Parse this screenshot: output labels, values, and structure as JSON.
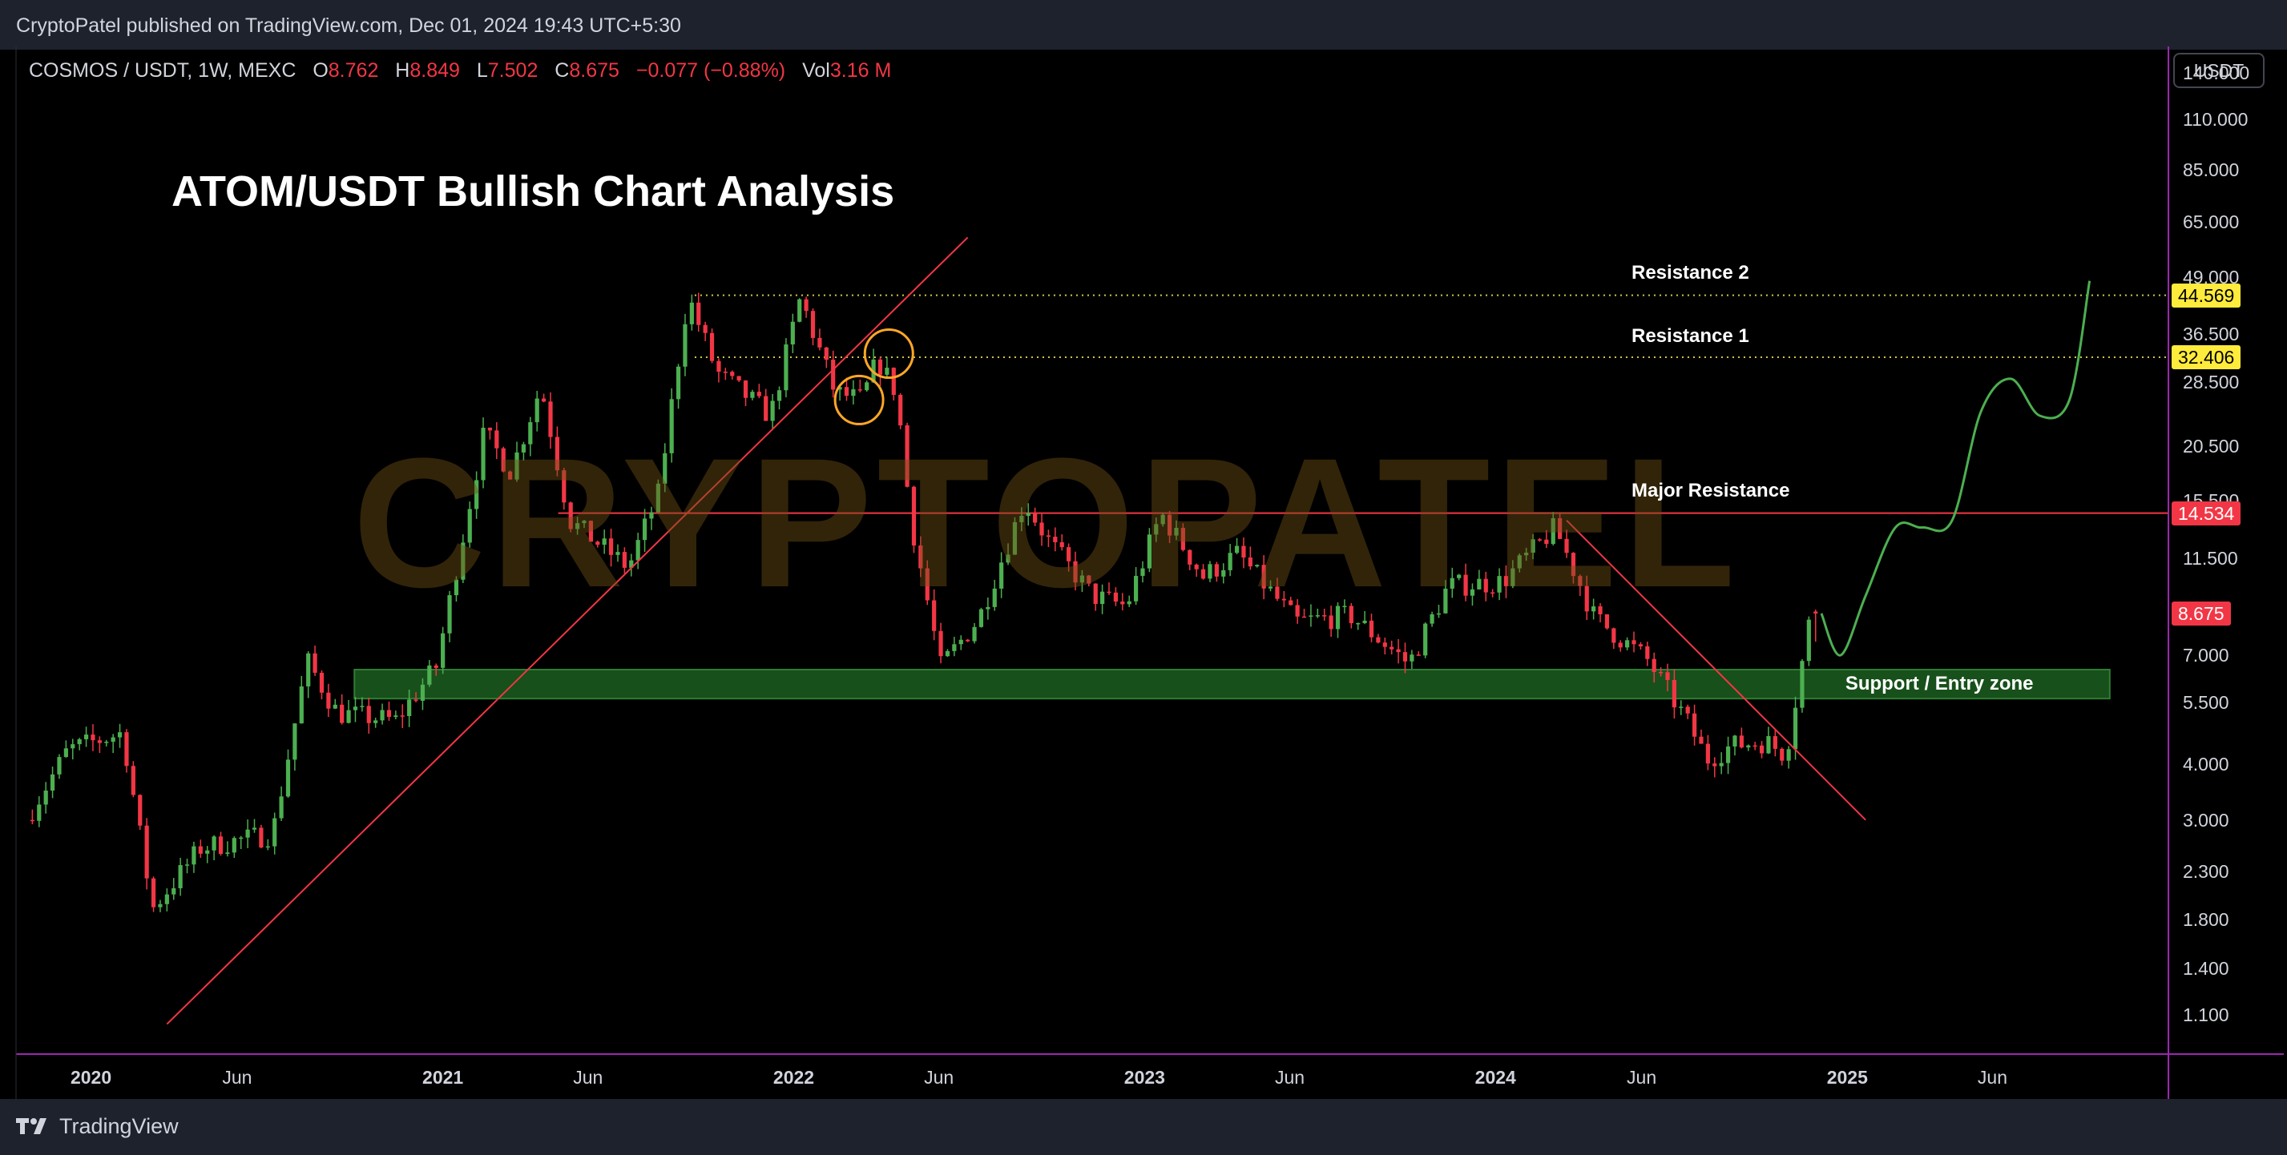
{
  "header": {
    "published": "CryptoPatel published on TradingView.com, Dec 01, 2024 19:43 UTC+5:30"
  },
  "legend": {
    "symbol": "COSMOS / USDT, 1W, MEXC",
    "o_label": "O",
    "o_value": "8.762",
    "h_label": "H",
    "h_value": "8.849",
    "l_label": "L",
    "l_value": "7.502",
    "c_label": "C",
    "c_value": "8.675",
    "change": "−0.077 (−0.88%)",
    "vol_label": "Vol",
    "vol_value": "3.16 M"
  },
  "currency_button": "USDT",
  "footer": {
    "brand": "TradingView"
  },
  "watermark": "CRYPTOPATEL",
  "colors": {
    "background": "#000000",
    "up_candle": "#26a69a",
    "up_candle_bright": "#4caf50",
    "down_candle": "#f23645",
    "trendline": "#f23645",
    "resistance_dotted": "#d4c94a",
    "support_zone_fill": "#1b5e20",
    "support_zone_border": "#2e7d32",
    "projection": "#4caf50",
    "circle_marker": "#ffa726",
    "last_price_tag": "#f23645",
    "resistance_tag": "#ffeb3b",
    "separator": "#9c27b0"
  },
  "chart_data": {
    "type": "candlestick",
    "symbol": "COSMOS / USDT",
    "interval": "1W",
    "exchange": "MEXC",
    "title": "ATOM/USDT Bullish Chart Analysis",
    "y_scale": "log",
    "ylim": [
      0.9,
      155
    ],
    "y_ticks": [
      "140.000",
      "110.000",
      "85.000",
      "65.000",
      "49.000",
      "36.500",
      "28.500",
      "20.500",
      "15.500",
      "11.500",
      "7.000",
      "5.500",
      "4.000",
      "3.000",
      "2.300",
      "1.800",
      "1.400",
      "1.100"
    ],
    "x_ticks": [
      {
        "label": "2020",
        "date": "2020-01-01",
        "bold": true
      },
      {
        "label": "Jun",
        "date": "2020-06-01",
        "bold": false
      },
      {
        "label": "2021",
        "date": "2021-01-01",
        "bold": true
      },
      {
        "label": "Jun",
        "date": "2021-06-01",
        "bold": false
      },
      {
        "label": "2022",
        "date": "2022-01-01",
        "bold": true
      },
      {
        "label": "Jun",
        "date": "2022-06-01",
        "bold": false
      },
      {
        "label": "2023",
        "date": "2023-01-01",
        "bold": true
      },
      {
        "label": "Jun",
        "date": "2023-06-01",
        "bold": false
      },
      {
        "label": "2024",
        "date": "2024-01-01",
        "bold": true
      },
      {
        "label": "Jun",
        "date": "2024-06-01",
        "bold": false
      },
      {
        "label": "2025",
        "date": "2025-01-01",
        "bold": true
      },
      {
        "label": "Jun",
        "date": "2025-06-01",
        "bold": false
      }
    ],
    "price_path": [
      [
        "2019-11-01",
        3.0
      ],
      [
        "2019-12-15",
        4.3
      ],
      [
        "2020-02-10",
        4.7
      ],
      [
        "2020-03-12",
        1.9
      ],
      [
        "2020-05-01",
        2.6
      ],
      [
        "2020-07-15",
        2.8
      ],
      [
        "2020-08-20",
        6.8
      ],
      [
        "2020-09-20",
        5.2
      ],
      [
        "2020-11-20",
        5.0
      ],
      [
        "2021-01-01",
        6.6
      ],
      [
        "2021-02-20",
        22.0
      ],
      [
        "2021-03-20",
        18.0
      ],
      [
        "2021-04-20",
        28.0
      ],
      [
        "2021-05-20",
        14.0
      ],
      [
        "2021-07-20",
        11.0
      ],
      [
        "2021-08-20",
        16.0
      ],
      [
        "2021-09-20",
        44.5
      ],
      [
        "2021-10-20",
        30.0
      ],
      [
        "2021-12-15",
        24.0
      ],
      [
        "2022-01-15",
        44.0
      ],
      [
        "2022-02-20",
        27.0
      ],
      [
        "2022-03-20",
        26.0
      ],
      [
        "2022-04-05",
        32.0
      ],
      [
        "2022-04-25",
        27.0
      ],
      [
        "2022-05-10",
        14.0
      ],
      [
        "2022-06-10",
        6.6
      ],
      [
        "2022-07-20",
        8.5
      ],
      [
        "2022-09-05",
        15.5
      ],
      [
        "2022-10-01",
        12.5
      ],
      [
        "2022-11-15",
        9.5
      ],
      [
        "2022-12-20",
        9.0
      ],
      [
        "2023-01-25",
        14.5
      ],
      [
        "2023-03-10",
        10.5
      ],
      [
        "2023-04-15",
        11.8
      ],
      [
        "2023-06-15",
        8.3
      ],
      [
        "2023-08-10",
        8.6
      ],
      [
        "2023-10-10",
        6.7
      ],
      [
        "2023-11-20",
        10.0
      ],
      [
        "2024-01-15",
        10.2
      ],
      [
        "2024-03-10",
        13.5
      ],
      [
        "2024-04-20",
        8.5
      ],
      [
        "2024-06-15",
        6.8
      ],
      [
        "2024-07-25",
        5.0
      ],
      [
        "2024-08-15",
        4.1
      ],
      [
        "2024-09-10",
        4.4
      ],
      [
        "2024-10-15",
        4.5
      ],
      [
        "2024-11-05",
        4.2
      ],
      [
        "2024-12-01",
        8.675
      ]
    ],
    "last": {
      "open": 8.762,
      "high": 8.849,
      "low": 7.502,
      "close": 8.675,
      "change": -0.077,
      "change_pct": -0.88,
      "volume": "3.16 M"
    },
    "levels": [
      {
        "label": "Resistance 2",
        "value": 44.569,
        "value_label": "44.569",
        "style": "dotted"
      },
      {
        "label": "Resistance 1",
        "value": 32.406,
        "value_label": "32.406",
        "style": "dotted"
      },
      {
        "label": "Major Resistance",
        "value": 14.534,
        "value_label": "14.534",
        "style": "solid"
      }
    ],
    "last_price_label": "8.675",
    "zones": [
      {
        "label": "Support / Entry zone",
        "low": 5.6,
        "high": 6.5,
        "from": "2020-10-01",
        "to": "2025-10-01"
      }
    ],
    "trendlines": [
      {
        "from": [
          "2020-03-20",
          1.05
        ],
        "to": [
          "2022-07-01",
          60.0
        ]
      },
      {
        "from": [
          "2024-03-15",
          14.0
        ],
        "to": [
          "2025-01-20",
          3.0
        ]
      }
    ],
    "circles": [
      {
        "date": "2022-03-10",
        "value": 26.0
      },
      {
        "date": "2022-04-10",
        "value": 33.0
      }
    ],
    "projection": [
      [
        "2024-12-05",
        8.675
      ],
      [
        "2024-12-25",
        7.0
      ],
      [
        "2025-01-20",
        9.5
      ],
      [
        "2025-02-20",
        13.5
      ],
      [
        "2025-03-20",
        13.5
      ],
      [
        "2025-04-20",
        14.0
      ],
      [
        "2025-05-20",
        24.5
      ],
      [
        "2025-06-20",
        29.0
      ],
      [
        "2025-07-20",
        24.0
      ],
      [
        "2025-08-20",
        26.0
      ],
      [
        "2025-09-10",
        48.0
      ]
    ]
  }
}
